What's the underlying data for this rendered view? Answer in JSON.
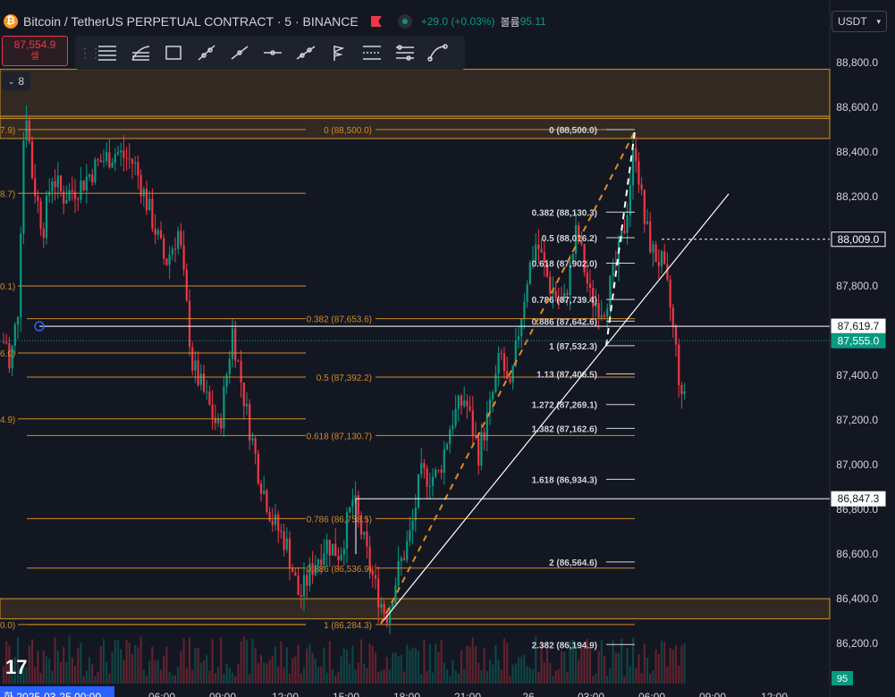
{
  "header": {
    "symbol": "Bitcoin / TetherUS PERPETUAL CONTRACT · 5 · BINANCE",
    "change": "+29.0 (+0.03%)",
    "volume_label": "볼륨",
    "volume_value": "95.11"
  },
  "price_box": {
    "price": "87,554.9",
    "side": "셀"
  },
  "toolbar": {
    "tools": [
      "horizontal-lines-icon",
      "ray-lines-icon",
      "rectangle-icon",
      "trend-line-icon",
      "line-icon",
      "horizontal-line-icon",
      "parallel-line-icon",
      "flag-pole-icon",
      "range-icon",
      "channel-icon",
      "curve-icon"
    ]
  },
  "indicator_toggle": "8",
  "currency": "USDT",
  "colors": {
    "bg": "#131722",
    "up": "#089981",
    "down": "#f23645",
    "fib": "#d18a28",
    "white": "#ffffff",
    "current": "#089981"
  },
  "chart_data": {
    "type": "candlestick",
    "symbol": "BTCUSDT.P",
    "timeframe": "5",
    "ylim": [
      86030,
      88980
    ],
    "y_ticks": [
      {
        "v": 86200,
        "t": "86,200.0"
      },
      {
        "v": 86400,
        "t": "86,400.0"
      },
      {
        "v": 86600,
        "t": "86,600.0"
      },
      {
        "v": 86800,
        "t": "86,800.0"
      },
      {
        "v": 87000,
        "t": "87,000.0"
      },
      {
        "v": 87200,
        "t": "87,200.0"
      },
      {
        "v": 87400,
        "t": "87,400.0"
      },
      {
        "v": 87600,
        "t": "87,600.0"
      },
      {
        "v": 87800,
        "t": "87,800.0"
      },
      {
        "v": 88000,
        "t": "88,000.0"
      },
      {
        "v": 88200,
        "t": "88,200.0"
      },
      {
        "v": 88400,
        "t": "88,400.0"
      },
      {
        "v": 88600,
        "t": "88,600.0"
      },
      {
        "v": 88800,
        "t": "88,800.0"
      }
    ],
    "x_ticks": [
      "화 2025-03-25 00:00",
      "06:00",
      "09:00",
      "12:00",
      "15:00",
      "18:00",
      "21:00",
      "26",
      "03:00",
      "06:00",
      "09:00",
      "12:00"
    ],
    "price_labels": [
      {
        "v": 88009.0,
        "t": "88,009.0",
        "style": "dark"
      },
      {
        "v": 87619.7,
        "t": "87,619.7",
        "style": "white"
      },
      {
        "v": 87555.0,
        "t": "87,555.0",
        "style": "current"
      },
      {
        "v": 86847.3,
        "t": "86,847.3",
        "style": "white"
      }
    ],
    "volume_badge": "95",
    "zones": [
      {
        "from": 88550,
        "to": 88770
      },
      {
        "from": 88460,
        "to": 88560
      },
      {
        "from": 86310,
        "to": 86400
      }
    ],
    "fib_retracement": [
      {
        "v": 88500.0,
        "t": "0 (88,500.0)"
      },
      {
        "v": 87653.6,
        "t": "0.382 (87,653.6)"
      },
      {
        "v": 87392.2,
        "t": "0.5 (87,392.2)"
      },
      {
        "v": 87130.7,
        "t": "0.618 (87,130.7)"
      },
      {
        "v": 86758.5,
        "t": "0.786 (86,758.5)"
      },
      {
        "v": 86536.9,
        "t": "0.886 (86,536.9)"
      },
      {
        "v": 86284.3,
        "t": "1 (86,284.3)"
      }
    ],
    "fib_left_partial": [
      {
        "v": 88500,
        "t": "7.9)"
      },
      {
        "v": 88215,
        "t": "8.7)"
      },
      {
        "v": 87800,
        "t": "0.1)"
      },
      {
        "v": 87500,
        "t": "6.0)"
      },
      {
        "v": 87205,
        "t": "4.9)"
      },
      {
        "v": 86284.3,
        "t": "0.0)"
      }
    ],
    "fib_extension": [
      {
        "v": 88500.0,
        "t": "0 (88,500.0)"
      },
      {
        "v": 88130.3,
        "t": "0.382 (88,130.3)"
      },
      {
        "v": 88016.2,
        "t": "0.5 (88,016.2)"
      },
      {
        "v": 87902.0,
        "t": "0.618 (87,902.0)"
      },
      {
        "v": 87739.4,
        "t": "0.786 (87,739.4)"
      },
      {
        "v": 87642.6,
        "t": "0.886 (87,642.6)"
      },
      {
        "v": 87532.3,
        "t": "1 (87,532.3)"
      },
      {
        "v": 87406.5,
        "t": "1.13 (87,406.5)"
      },
      {
        "v": 87269.1,
        "t": "1.272 (87,269.1)"
      },
      {
        "v": 87162.6,
        "t": "1.382 (87,162.6)"
      },
      {
        "v": 86934.3,
        "t": "1.618 (86,934.3)"
      },
      {
        "v": 86564.6,
        "t": "2 (86,564.6)"
      },
      {
        "v": 86194.9,
        "t": "2.382 (86,194.9)"
      }
    ]
  }
}
